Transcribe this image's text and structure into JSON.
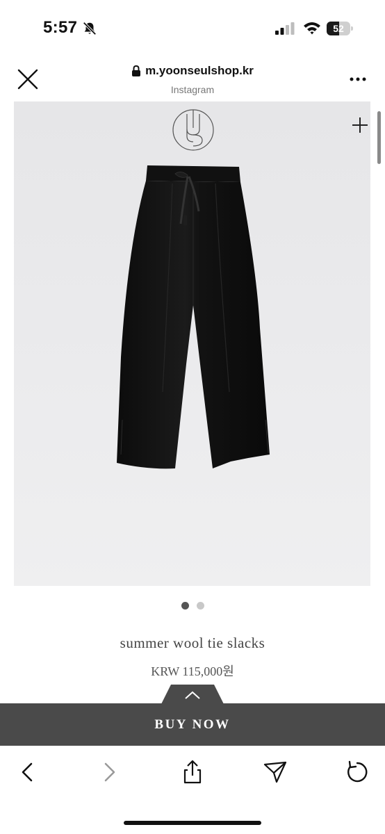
{
  "status_bar": {
    "time": "5:57",
    "battery_level": "52",
    "battery_fraction": 0.52,
    "icons": [
      "bell-off-icon",
      "cellular-signal-icon",
      "wifi-icon",
      "battery-icon"
    ]
  },
  "browser": {
    "domain": "m.yoonseulshop.kr",
    "source_label": "Instagram",
    "icons": [
      "close-icon",
      "lock-icon",
      "more-icon"
    ]
  },
  "product": {
    "name": "summer wool tie slacks",
    "price": "KRW 115,000원",
    "image_icons": [
      "brand-logo",
      "plus-icon"
    ],
    "carousel": {
      "total": 2,
      "active_index": 0
    }
  },
  "buy_bar": {
    "label": "BUY NOW",
    "tab_icon": "chevron-up-icon"
  },
  "toolbar": {
    "items": [
      "back-icon",
      "forward-icon",
      "share-icon",
      "send-icon",
      "reload-icon"
    ]
  },
  "colors": {
    "buy_bar_bg": "#4a4a4a",
    "dot_active": "#555555",
    "dot_inactive": "#c8c8c8"
  }
}
